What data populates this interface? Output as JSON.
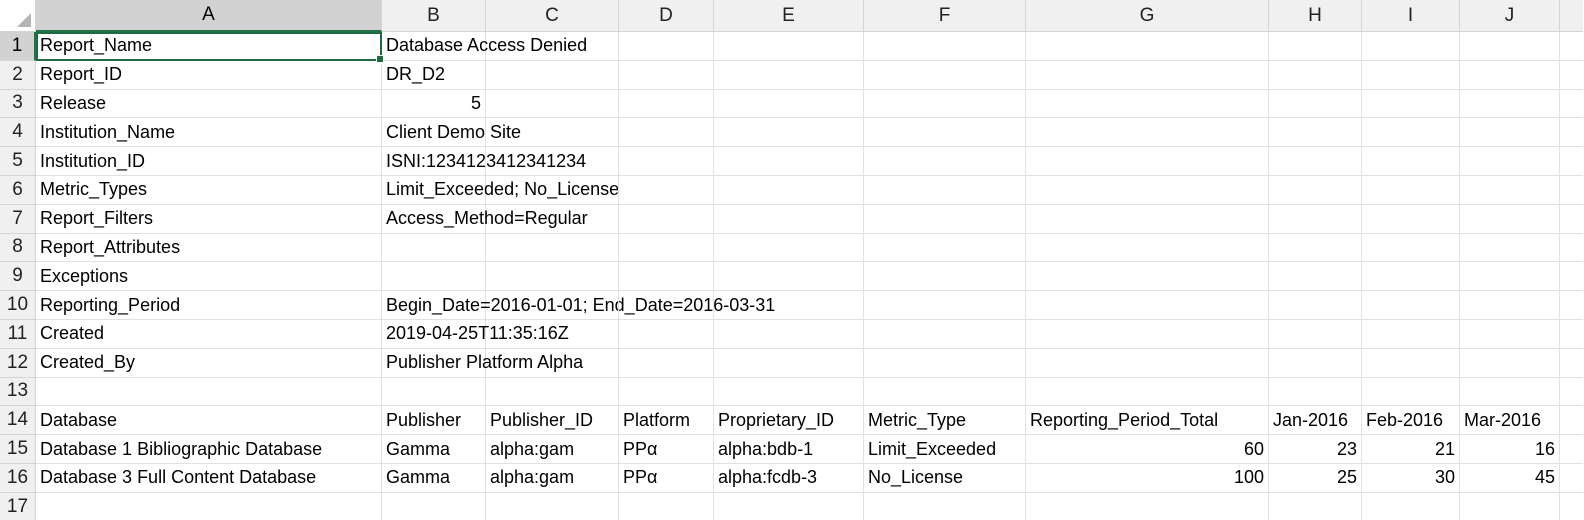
{
  "app": {
    "active_cell": "A1"
  },
  "columns": [
    "A",
    "B",
    "C",
    "D",
    "E",
    "F",
    "G",
    "H",
    "I",
    "J"
  ],
  "rows": [
    {
      "n": "1",
      "cells": [
        "Report_Name",
        "Database Access Denied",
        "",
        "",
        "",
        "",
        "",
        "",
        "",
        ""
      ]
    },
    {
      "n": "2",
      "cells": [
        "Report_ID",
        "DR_D2",
        "",
        "",
        "",
        "",
        "",
        "",
        "",
        ""
      ]
    },
    {
      "n": "3",
      "cells": [
        "Release",
        "5",
        "",
        "",
        "",
        "",
        "",
        "",
        "",
        ""
      ]
    },
    {
      "n": "4",
      "cells": [
        "Institution_Name",
        "Client Demo Site",
        "",
        "",
        "",
        "",
        "",
        "",
        "",
        ""
      ]
    },
    {
      "n": "5",
      "cells": [
        "Institution_ID",
        "ISNI:1234123412341234",
        "",
        "",
        "",
        "",
        "",
        "",
        "",
        ""
      ]
    },
    {
      "n": "6",
      "cells": [
        "Metric_Types",
        "Limit_Exceeded; No_License",
        "",
        "",
        "",
        "",
        "",
        "",
        "",
        ""
      ]
    },
    {
      "n": "7",
      "cells": [
        "Report_Filters",
        "Access_Method=Regular",
        "",
        "",
        "",
        "",
        "",
        "",
        "",
        ""
      ]
    },
    {
      "n": "8",
      "cells": [
        "Report_Attributes",
        "",
        "",
        "",
        "",
        "",
        "",
        "",
        "",
        ""
      ]
    },
    {
      "n": "9",
      "cells": [
        "Exceptions",
        "",
        "",
        "",
        "",
        "",
        "",
        "",
        "",
        ""
      ]
    },
    {
      "n": "10",
      "cells": [
        "Reporting_Period",
        "Begin_Date=2016-01-01; End_Date=2016-03-31",
        "",
        "",
        "",
        "",
        "",
        "",
        "",
        ""
      ]
    },
    {
      "n": "11",
      "cells": [
        "Created",
        "2019-04-25T11:35:16Z",
        "",
        "",
        "",
        "",
        "",
        "",
        "",
        ""
      ]
    },
    {
      "n": "12",
      "cells": [
        "Created_By",
        "Publisher Platform Alpha",
        "",
        "",
        "",
        "",
        "",
        "",
        "",
        ""
      ]
    },
    {
      "n": "13",
      "cells": [
        "",
        "",
        "",
        "",
        "",
        "",
        "",
        "",
        "",
        ""
      ]
    },
    {
      "n": "14",
      "cells": [
        "Database",
        "Publisher",
        "Publisher_ID",
        "Platform",
        "Proprietary_ID",
        "Metric_Type",
        "Reporting_Period_Total",
        "Jan-2016",
        "Feb-2016",
        "Mar-2016"
      ]
    },
    {
      "n": "15",
      "cells": [
        "Database 1 Bibliographic Database",
        "Gamma",
        "alpha:gam",
        "PPα",
        "alpha:bdb-1",
        "Limit_Exceeded",
        "60",
        "23",
        "21",
        "16"
      ]
    },
    {
      "n": "16",
      "cells": [
        "Database 3 Full Content Database",
        "Gamma",
        "alpha:gam",
        "PPα",
        "alpha:fcdb-3",
        "No_License",
        "100",
        "25",
        "30",
        "45"
      ]
    },
    {
      "n": "17",
      "cells": [
        "",
        "",
        "",
        "",
        "",
        "",
        "",
        "",
        "",
        ""
      ]
    }
  ],
  "numeric_cells": [
    "3-1",
    "15-6",
    "15-7",
    "15-8",
    "15-9",
    "16-6",
    "16-7",
    "16-8",
    "16-9"
  ]
}
